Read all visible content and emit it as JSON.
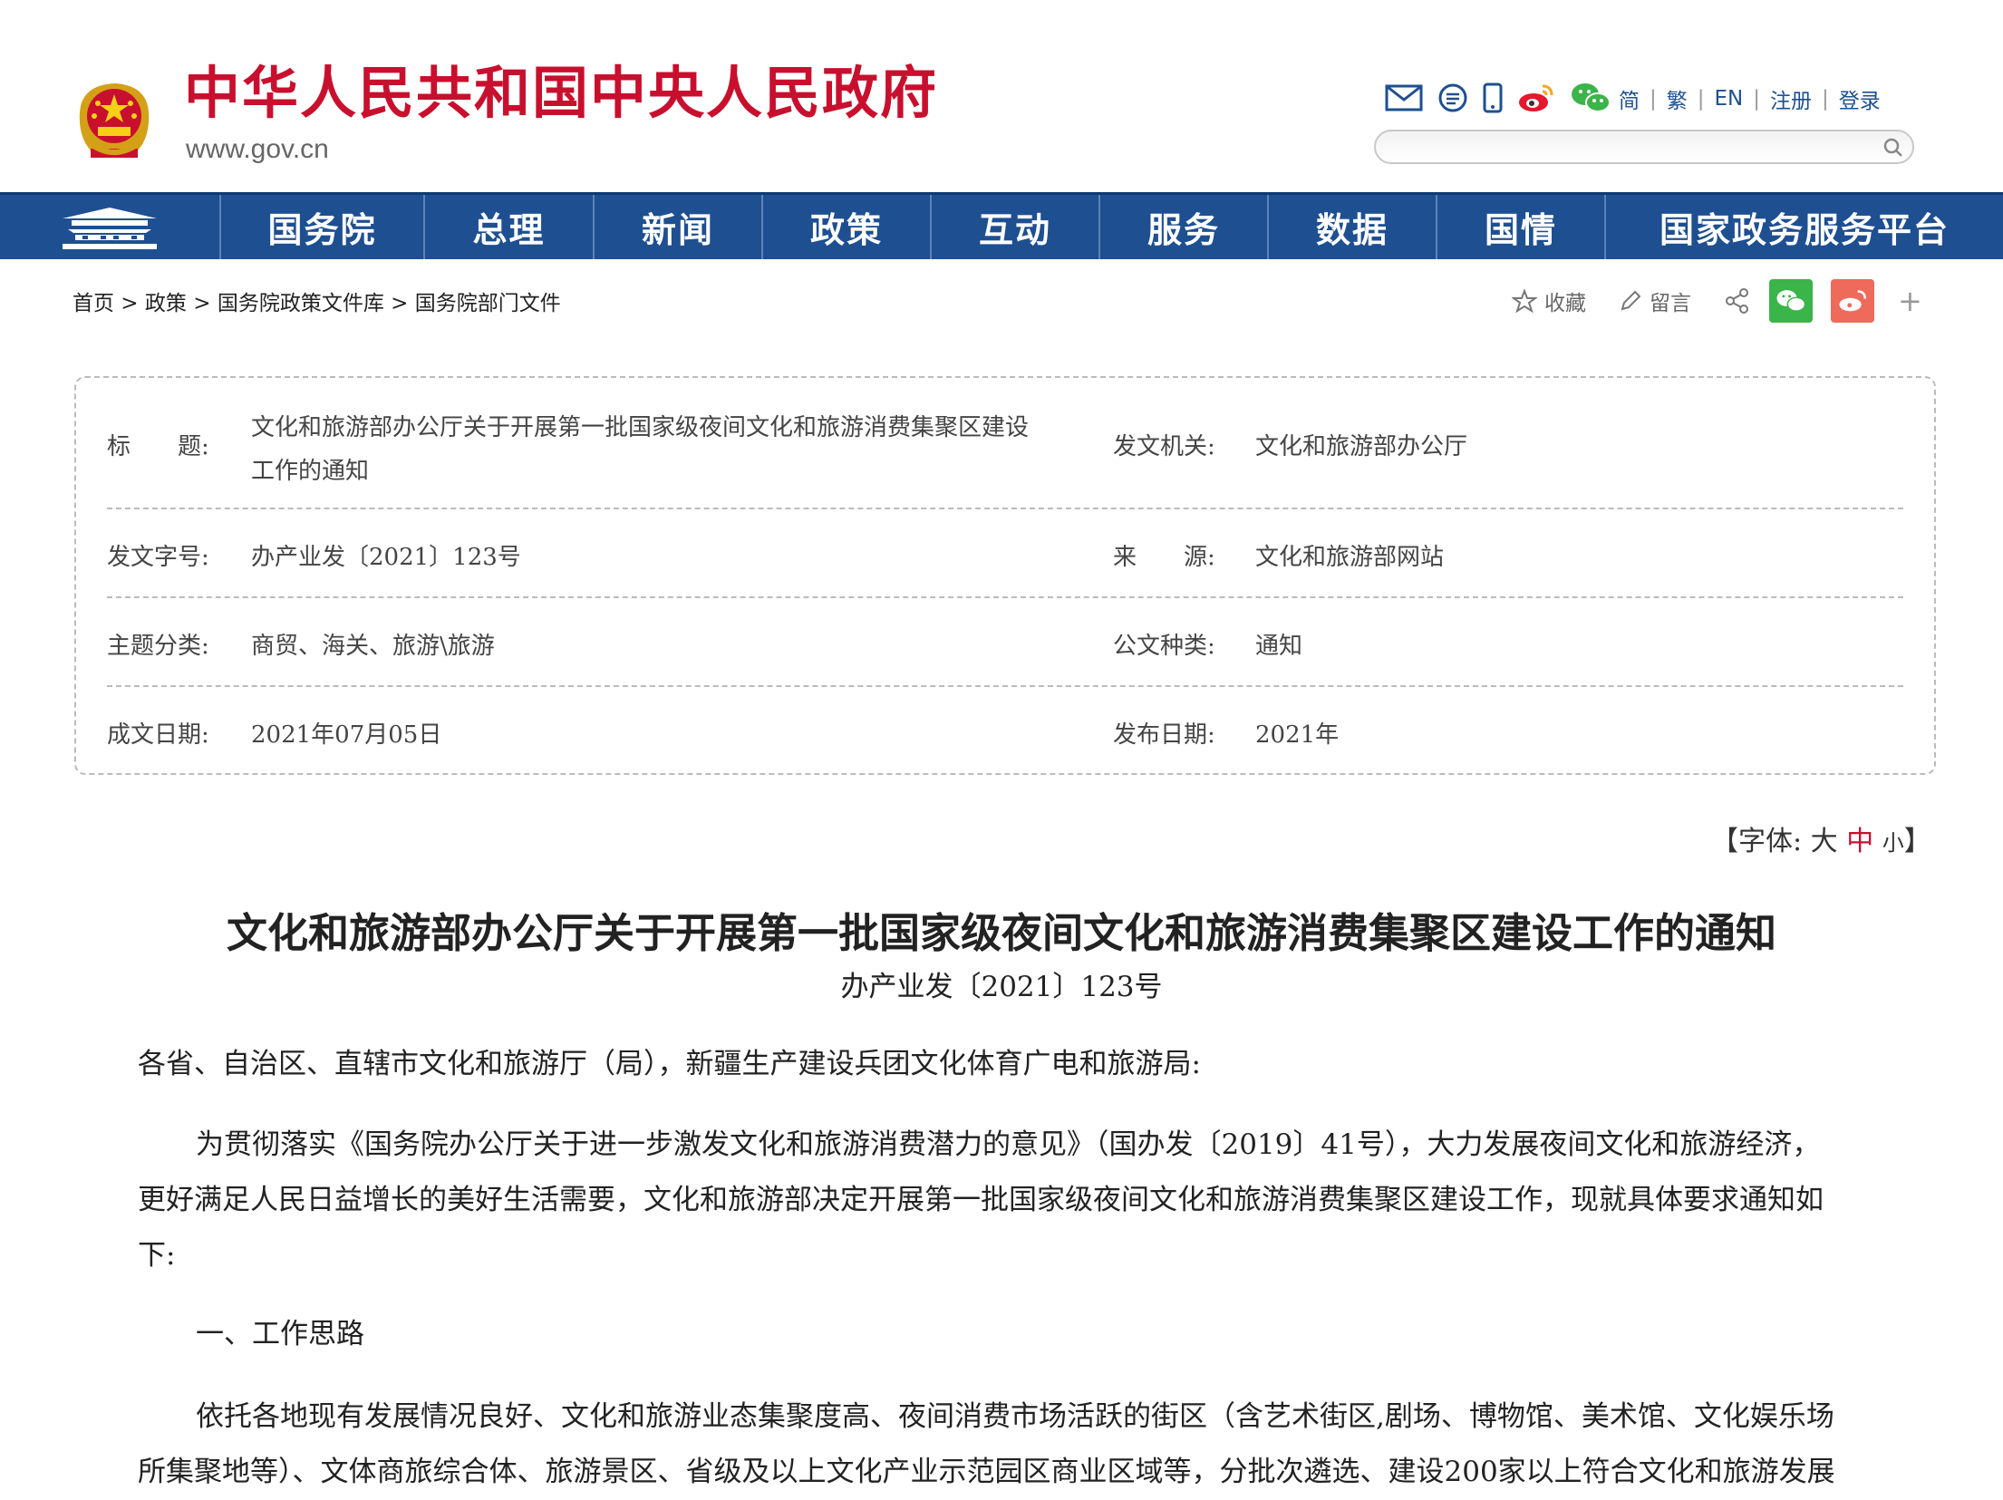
{
  "header": {
    "site_title": "中华人民共和国中央人民政府",
    "site_domain": "www.gov.cn",
    "icons": [
      "mail-icon",
      "message-icon",
      "mobile-icon",
      "weibo-icon",
      "wechat-icon"
    ],
    "lang_links": [
      "简",
      "繁",
      "EN",
      "注册",
      "登录"
    ],
    "search_placeholder": ""
  },
  "nav": {
    "items": [
      "国务院",
      "总理",
      "新闻",
      "政策",
      "互动",
      "服务",
      "数据",
      "国情",
      "国家政务服务平台"
    ],
    "colors": {
      "bar": "#1e4f91",
      "brand_red": "#c8102e"
    }
  },
  "breadcrumb": [
    "首页",
    "政策",
    "国务院政策文件库",
    "国务院部门文件"
  ],
  "breadcrumb_sep": " > ",
  "tools": {
    "favorite": "收藏",
    "comment": "留言",
    "share_icon": "share-icon",
    "wechat_icon": "wechat-share-icon",
    "weibo_icon": "weibo-share-icon",
    "more": "+"
  },
  "info": {
    "title_label": "标　　题:",
    "title_value_l1": "文化和旅游部办公厅关于开展第一批国家级夜间文化和旅游消费集聚区建设",
    "title_value_l2": "工作的通知",
    "issuer_label": "发文机关:",
    "issuer_value": "文化和旅游部办公厅",
    "docno_label": "发文字号:",
    "docno_value": "办产业发〔2021〕123号",
    "source_label": "来　　源:",
    "source_value": "文化和旅游部网站",
    "topic_label": "主题分类:",
    "topic_value": "商贸、海关、旅游\\旅游",
    "type_label": "公文种类:",
    "type_value": "通知",
    "written_label": "成文日期:",
    "written_value": "2021年07月05日",
    "publish_label": "发布日期:",
    "publish_value": "2021年"
  },
  "font_size": {
    "prefix": "【字体:",
    "large": "大",
    "medium": "中",
    "small": "小",
    "suffix": "】"
  },
  "document": {
    "title": "文化和旅游部办公厅关于开展第一批国家级夜间文化和旅游消费集聚区建设工作的通知",
    "number": "办产业发〔2021〕123号",
    "salutation": "各省、自治区、直辖市文化和旅游厅（局），新疆生产建设兵团文化体育广电和旅游局:",
    "p1_l1": "为贯彻落实《国务院办公厅关于进一步激发文化和旅游消费潜力的意见》（国办发〔2019〕41号），大力发展夜间文化和旅游经济，",
    "p1_l2": "更好满足人民日益增长的美好生活需要，文化和旅游部决定开展第一批国家级夜间文化和旅游消费集聚区建设工作，现就具体要求通知如",
    "p1_l3": "下:",
    "section1": "一、工作思路",
    "p2_l1": "依托各地现有发展情况良好、文化和旅游业态集聚度高、夜间消费市场活跃的街区（含艺术街区,剧场、博物馆、美术馆、文化娱乐场",
    "p2_l2": "所集聚地等）、文体商旅综合体、旅游景区、省级及以上文化产业示范园区商业区域等，分批次遴选、建设200家以上符合文化和旅游发展"
  }
}
